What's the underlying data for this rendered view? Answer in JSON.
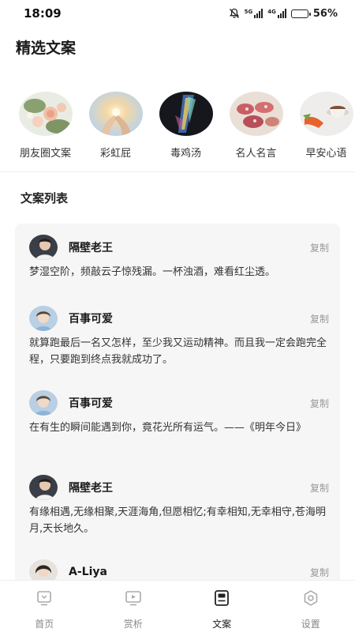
{
  "status": {
    "time": "18:09",
    "battery": "56%",
    "battery_level": 0.56,
    "net1": "5G",
    "net2": "4G"
  },
  "header": {
    "title": "精选文案"
  },
  "categories": [
    {
      "label": "朋友圈文案",
      "icon": "flowers-image"
    },
    {
      "label": "彩虹屁",
      "icon": "hands-light-image"
    },
    {
      "label": "毒鸡汤",
      "icon": "prism-light-image"
    },
    {
      "label": "名人名言",
      "icon": "food-image"
    },
    {
      "label": "早安心语",
      "icon": "coffee-image"
    }
  ],
  "list": {
    "title": "文案列表",
    "copy_label": "复制",
    "items": [
      {
        "author": "隔壁老王",
        "text": "梦湿空阶，频敲云子惊残漏。一杯浊酒，难看红尘透。"
      },
      {
        "author": "百事可爱",
        "text": "就算跑最后一名又怎样，至少我又运动精神。而且我一定会跑完全程，只要跑到终点我就成功了。"
      },
      {
        "author": "百事可爱",
        "text": "在有生的瞬间能遇到你，竟花光所有运气。——《明年今日》"
      },
      {
        "author": "隔壁老王",
        "text": "有缘相遇,无缘相聚,天涯海角,但愿相忆;有幸相知,无幸相守,苍海明月,天长地久。"
      },
      {
        "author": "A-Liya",
        "text": ""
      }
    ]
  },
  "tabbar": {
    "tabs": [
      {
        "label": "首页",
        "icon": "home-icon"
      },
      {
        "label": "赏析",
        "icon": "play-icon"
      },
      {
        "label": "文案",
        "icon": "document-icon"
      },
      {
        "label": "设置",
        "icon": "settings-icon"
      }
    ],
    "active_index": 2
  },
  "colors": {
    "background": "#ffffff",
    "card": "#f6f6f6",
    "muted": "#999999",
    "active": "#222222"
  }
}
